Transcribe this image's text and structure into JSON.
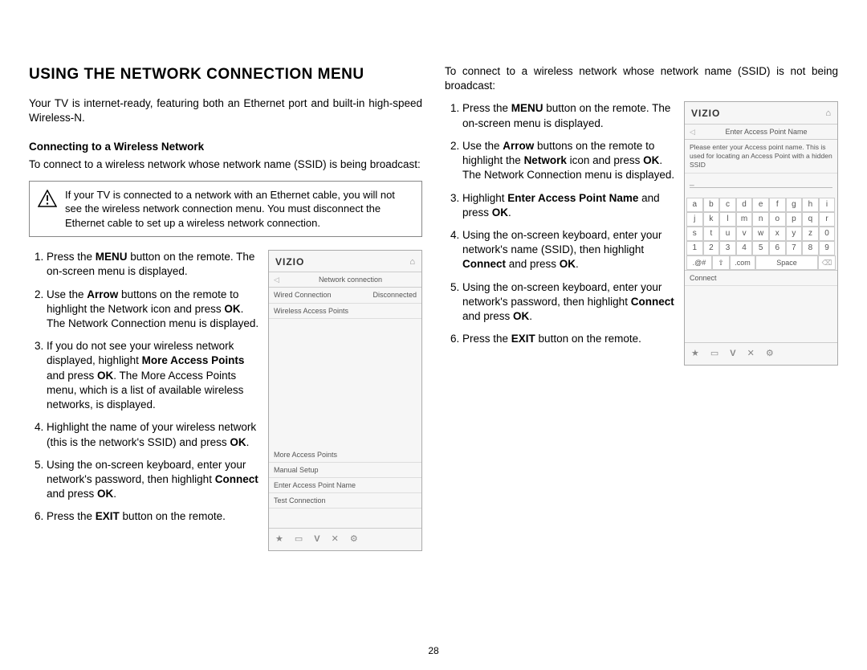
{
  "page_number": "28",
  "left": {
    "heading": "USING THE NETWORK CONNECTION MENU",
    "intro": "Your TV is internet-ready, featuring both an Ethernet port and built-in high-speed Wireless-N.",
    "subhead": "Connecting to a Wireless Network",
    "lead": "To connect to a wireless network whose network name (SSID) is being broadcast:",
    "warning": "If your TV is connected to a network with an Ethernet cable, you will not see the wireless network connection menu. You must disconnect the Ethernet cable to set up a wireless network connection.",
    "steps": [
      {
        "pre": "Press the ",
        "b1": "MENU",
        "post1": " button on the remote. The on-screen menu is displayed."
      },
      {
        "pre": "Use the ",
        "b1": "Arrow",
        "post1": " buttons on the remote to highlight the Network icon and press ",
        "b2": "OK",
        "post2": ". The Network Connection menu is displayed."
      },
      {
        "pre": "If you do not see your wireless network displayed, highlight ",
        "b1": "More Access Points",
        "post1": " and press ",
        "b2": "OK",
        "post2": ". The More Access Points menu, which is a list of available wireless networks, is displayed."
      },
      {
        "pre": "Highlight the name of your wireless network (this is the network's SSID) and press ",
        "b1": "OK",
        "post1": "."
      },
      {
        "pre": "Using the on-screen keyboard, enter your network's password, then highlight ",
        "b1": "Connect",
        "post1": " and press ",
        "b2": "OK",
        "post2": "."
      },
      {
        "pre": "Press the ",
        "b1": "EXIT",
        "post1": " button on the remote."
      }
    ]
  },
  "right": {
    "lead": "To connect to a wireless network whose network name (SSID) is not being broadcast:",
    "steps": [
      {
        "pre": "Press the ",
        "b1": "MENU",
        "post1": " button on the remote. The on-screen menu is displayed."
      },
      {
        "pre": "Use the ",
        "b1": "Arrow",
        "post1": " buttons on the remote to highlight the ",
        "b2": "Network",
        "post2": " icon and press ",
        "b3": "OK",
        "post3": ". The Network Connection menu is displayed."
      },
      {
        "pre": "Highlight ",
        "b1": "Enter Access Point Name",
        "post1": " and press ",
        "b2": "OK",
        "post2": "."
      },
      {
        "pre": "Using the on-screen keyboard, enter your network's name (SSID), then highlight ",
        "b1": "Connect",
        "post1": " and press ",
        "b2": "OK",
        "post2": "."
      },
      {
        "pre": "Using the on-screen keyboard, enter your network's password, then highlight ",
        "b1": "Connect",
        "post1": " and press ",
        "b2": "OK",
        "post2": "."
      },
      {
        "pre": "Press the ",
        "b1": "EXIT",
        "post1": " button on the remote."
      }
    ]
  },
  "mock1": {
    "logo": "VIZIO",
    "title": "Network connection",
    "row1_left": "Wired Connection",
    "row1_right": "Disconnected",
    "row2": "Wireless Access Points",
    "rows_bottom": [
      "More Access Points",
      "Manual Setup",
      "Enter Access Point Name",
      "Test Connection"
    ],
    "footer": [
      "★",
      "▭",
      "V",
      "✕",
      "⚙"
    ]
  },
  "mock2": {
    "logo": "VIZIO",
    "title": "Enter Access Point Name",
    "note": "Please enter your Access point name. This is used for locating an Access Point with a hidden SSID",
    "underscore": "_",
    "keys": [
      "a",
      "b",
      "c",
      "d",
      "e",
      "f",
      "g",
      "h",
      "i",
      "j",
      "k",
      "l",
      "m",
      "n",
      "o",
      "p",
      "q",
      "r",
      "s",
      "t",
      "u",
      "v",
      "w",
      "x",
      "y",
      "z",
      "0",
      "1",
      "2",
      "3",
      "4",
      "5",
      "6",
      "7",
      "8",
      "9"
    ],
    "sym": ".@#",
    "shift": "⇧",
    "com": ".com",
    "space": "Space",
    "del": "⌫",
    "connect": "Connect",
    "footer": [
      "★",
      "▭",
      "V",
      "✕",
      "⚙"
    ]
  }
}
